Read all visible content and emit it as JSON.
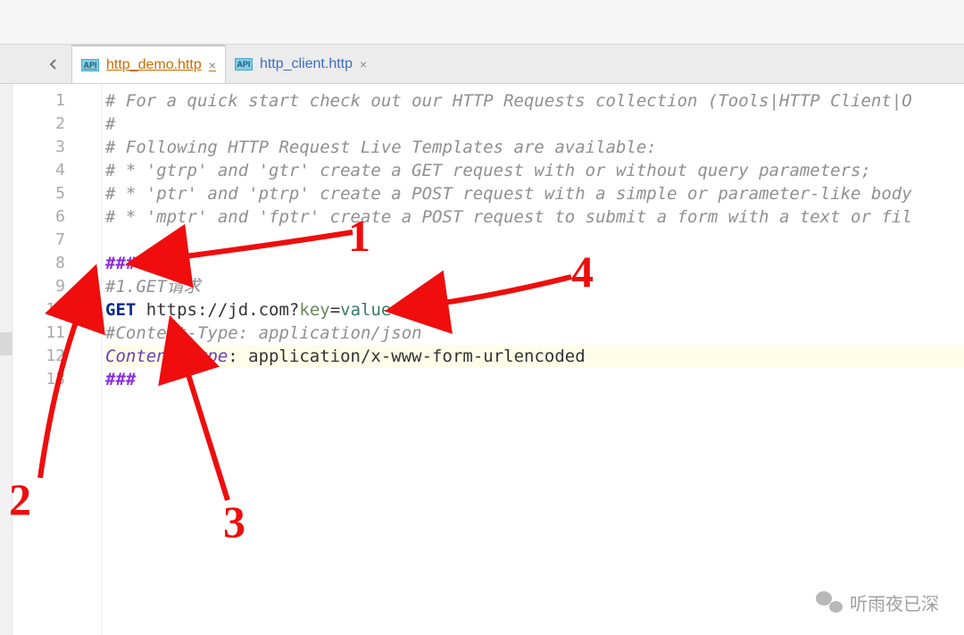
{
  "tabs": [
    {
      "label": "http_demo.http",
      "active": true
    },
    {
      "label": "http_client.http",
      "active": false
    }
  ],
  "api_icon_text": "API",
  "gutter": {
    "start": 1,
    "end": 13,
    "run_line": 10
  },
  "code": {
    "lines": [
      {
        "type": "comment",
        "text": "# For a quick start check out our HTTP Requests collection (Tools|HTTP Client|O"
      },
      {
        "type": "comment",
        "text": "#"
      },
      {
        "type": "comment",
        "text": "# Following HTTP Request Live Templates are available:"
      },
      {
        "type": "comment",
        "text": "# * 'gtrp' and 'gtr' create a GET request with or without query parameters;"
      },
      {
        "type": "comment",
        "text": "# * 'ptr' and 'ptrp' create a POST request with a simple or parameter-like body"
      },
      {
        "type": "comment",
        "text": "# * 'mptr' and 'fptr' create a POST request to submit a form with a text or fil"
      },
      {
        "type": "blank",
        "text": ""
      },
      {
        "type": "separator",
        "text": "###"
      },
      {
        "type": "comment",
        "text": "#1.GET请求"
      },
      {
        "type": "request",
        "method": "GET",
        "url_base": "https://jd.com",
        "qkey": "key",
        "qval": "value"
      },
      {
        "type": "comment",
        "text": "#Content-Type: application/json"
      },
      {
        "type": "header",
        "name": "Content-Type",
        "value": "application/x-www-form-urlencoded",
        "highlight": true
      },
      {
        "type": "separator",
        "text": "###"
      }
    ]
  },
  "annotations": {
    "labels": {
      "a1": "1",
      "a2": "2",
      "a3": "3",
      "a4": "4"
    }
  },
  "wechat": "听雨夜已深"
}
